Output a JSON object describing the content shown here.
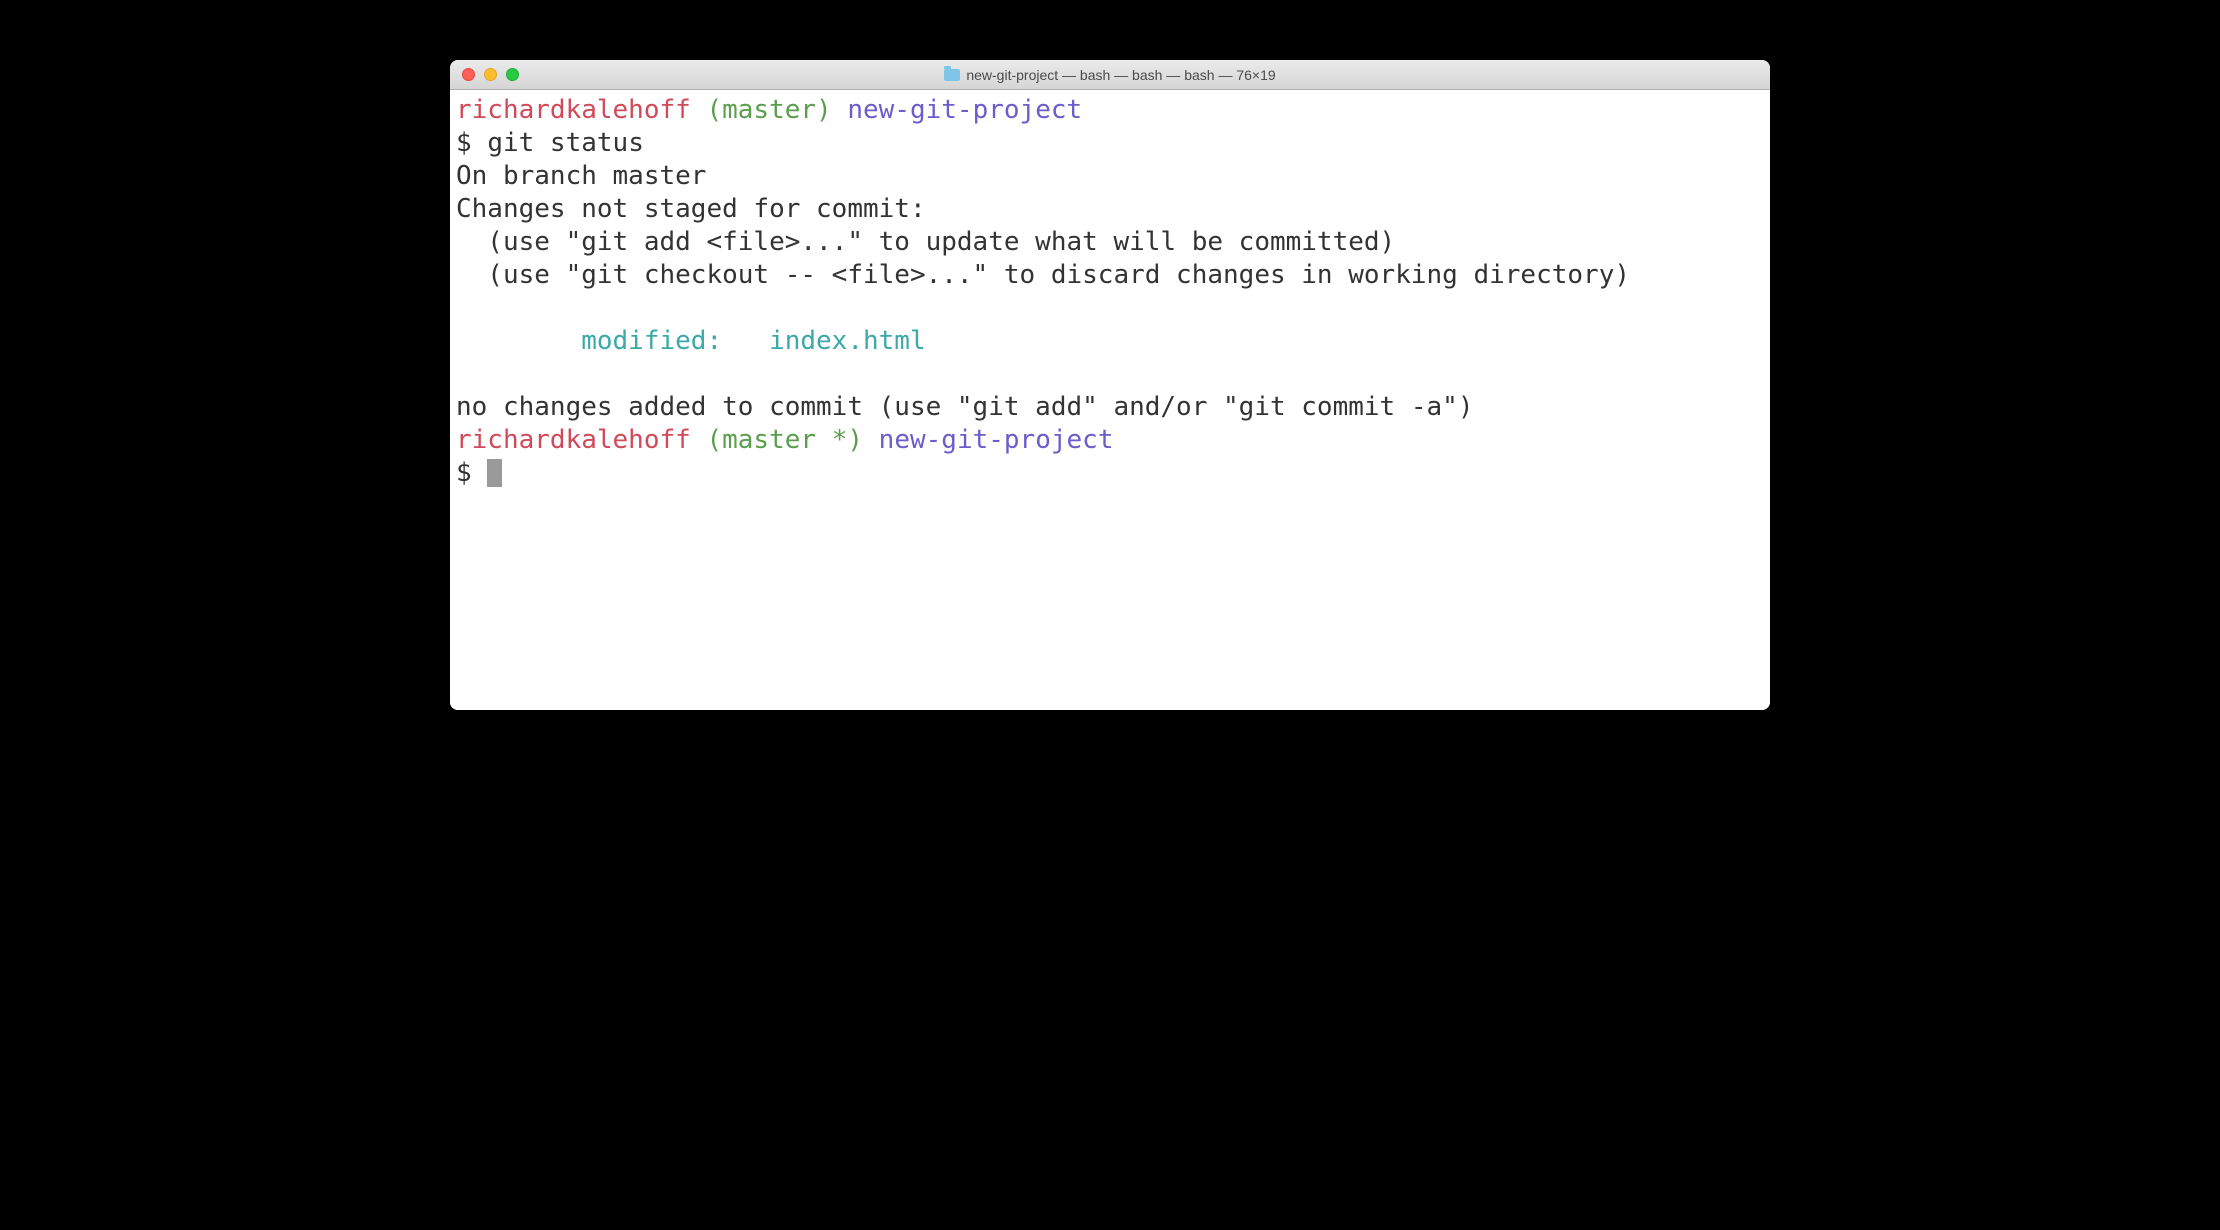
{
  "window": {
    "title": "new-git-project — bash — bash — bash — 76×19"
  },
  "prompt1": {
    "user": "richardkalehoff",
    "branch": "(master)",
    "dir": "new-git-project",
    "symbol": "$ ",
    "command": "git status"
  },
  "output": {
    "line1": "On branch master",
    "line2": "Changes not staged for commit:",
    "line3": "  (use \"git add <file>...\" to update what will be committed)",
    "line4": "  (use \"git checkout -- <file>...\" to discard changes in working directory)",
    "blank1": "",
    "modified": "        modified:   index.html",
    "blank2": "",
    "line5": "no changes added to commit (use \"git add\" and/or \"git commit -a\")"
  },
  "prompt2": {
    "user": "richardkalehoff",
    "branch": "(master *)",
    "dir": "new-git-project",
    "symbol": "$ "
  }
}
